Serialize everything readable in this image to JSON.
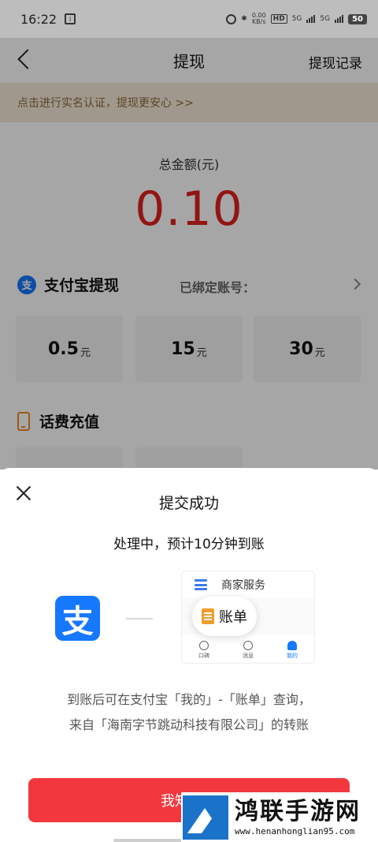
{
  "status_bar": {
    "time": "16:22",
    "network_speed_value": "0.00",
    "network_speed_unit": "KB/s",
    "hd": "HD",
    "signal1": "5G",
    "signal2": "5G",
    "battery": "50"
  },
  "nav": {
    "title": "提现",
    "right_link": "提现记录"
  },
  "verify_banner": "点击进行实名认证，提现更安心 >>",
  "balance": {
    "label": "总金额(元)",
    "amount": "0.10"
  },
  "alipay_section": {
    "icon": "支",
    "title": "支付宝提现",
    "bound_label": "已绑定账号：",
    "options": [
      {
        "value": "0.5",
        "unit": "元"
      },
      {
        "value": "15",
        "unit": "元"
      },
      {
        "value": "30",
        "unit": "元"
      }
    ]
  },
  "phone_section": {
    "title": "话费充值"
  },
  "sheet": {
    "title": "提交成功",
    "subtitle": "处理中，预计10分钟到账",
    "alipay_icon": "支",
    "preview": {
      "service": "商家服务",
      "bill": "账单",
      "tabs": [
        "口碑",
        "消息",
        "我的"
      ]
    },
    "note_line1": "到账后可在支付宝「我的」-「账单」查询，",
    "note_line2": "来自「海南字节跳动科技有限公司」的转账",
    "button": "我知道了"
  },
  "watermark": {
    "title": "鸿联手游网",
    "url": "www.henanhonglian95.com"
  }
}
